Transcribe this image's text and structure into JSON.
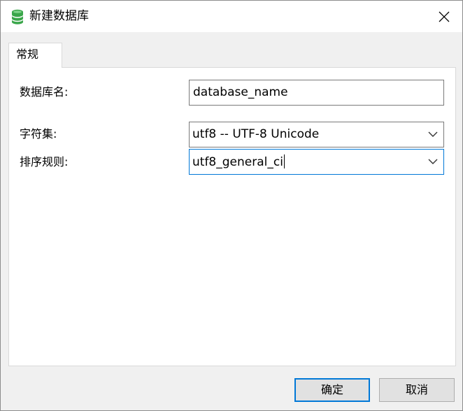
{
  "window": {
    "title": "新建数据库",
    "icon": "database-icon",
    "close_icon": "close-icon"
  },
  "tabs": [
    {
      "label": "常规",
      "active": true
    }
  ],
  "form": {
    "database_name": {
      "label": "数据库名:",
      "value": "database_name"
    },
    "charset": {
      "label": "字符集:",
      "value": "utf8 -- UTF-8 Unicode"
    },
    "collation": {
      "label": "排序规则:",
      "value": "utf8_general_ci"
    }
  },
  "buttons": {
    "ok": "确定",
    "cancel": "取消"
  },
  "colors": {
    "accent": "#0078d7",
    "db_icon": "#3aa64a"
  }
}
